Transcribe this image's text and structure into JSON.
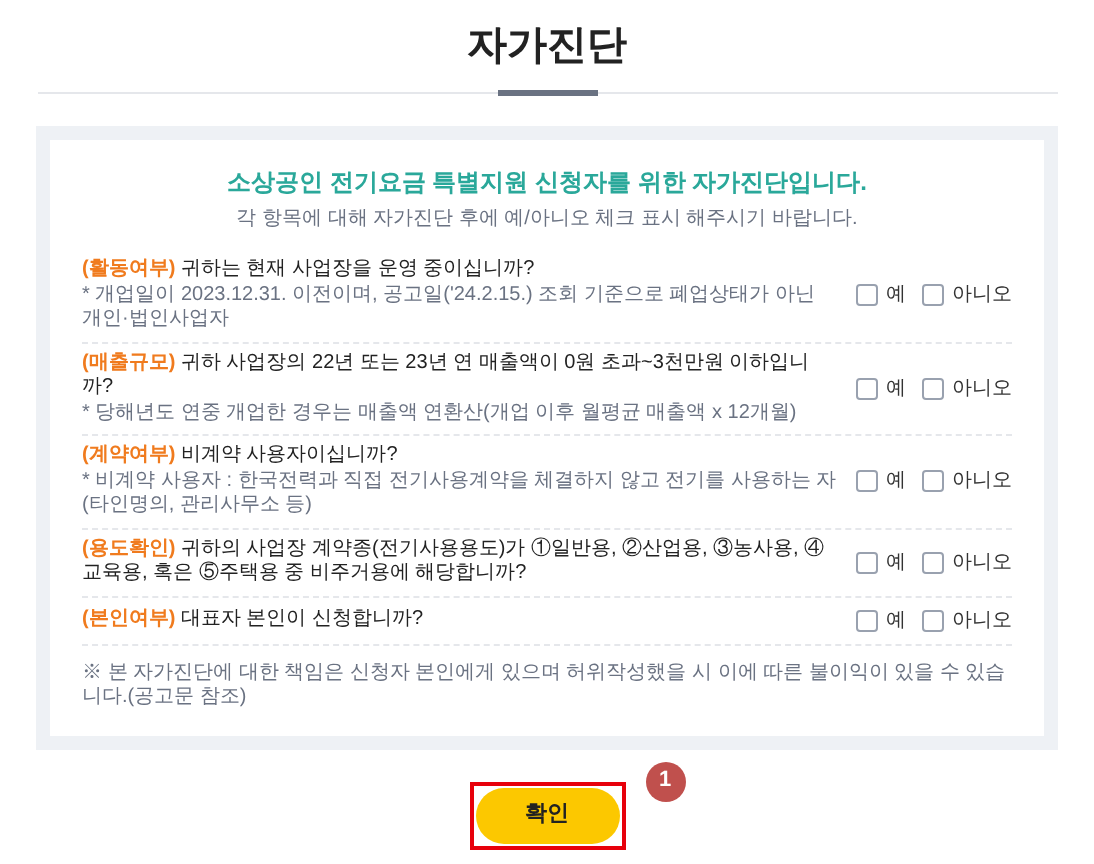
{
  "page_title": "자가진단",
  "heading": "소상공인 전기요금 특별지원 신청자를 위한 자가진단입니다.",
  "subheading": "각 항목에 대해 자가진단 후에 예/아니오 체크 표시 해주시기 바랍니다.",
  "questions": [
    {
      "tag": "(활동여부)",
      "text": "귀하는 현재 사업장을 운영 중이십니까?",
      "note": "* 개업일이 2023.12.31. 이전이며, 공고일('24.2.15.) 조회 기준으로 폐업상태가 아닌 개인·법인사업자",
      "options": [
        {
          "label": "예",
          "checked": false
        },
        {
          "label": "아니오",
          "checked": false
        }
      ]
    },
    {
      "tag": "(매출규모)",
      "text": "귀하 사업장의 22년 또는 23년 연 매출액이 0원 초과~3천만원 이하입니까?",
      "note": "* 당해년도 연중 개업한 경우는 매출액 연환산(개업 이후 월평균 매출액 x 12개월)",
      "options": [
        {
          "label": "예",
          "checked": false
        },
        {
          "label": "아니오",
          "checked": false
        }
      ]
    },
    {
      "tag": "(계약여부)",
      "text": "비계약 사용자이십니까?",
      "note": "* 비계약 사용자 : 한국전력과 직접 전기사용계약을 체결하지 않고 전기를 사용하는 자(타인명의, 관리사무소 등)",
      "options": [
        {
          "label": "예",
          "checked": false
        },
        {
          "label": "아니오",
          "checked": false
        }
      ]
    },
    {
      "tag": "(용도확인)",
      "text": "귀하의 사업장 계약종(전기사용용도)가 ①일반용, ②산업용, ③농사용, ④교육용, 혹은 ⑤주택용 중 비주거용에 해당합니까?",
      "options": [
        {
          "label": "예",
          "checked": false
        },
        {
          "label": "아니오",
          "checked": false
        }
      ]
    },
    {
      "tag": "(본인여부)",
      "text": "대표자 본인이 신청합니까?",
      "options": [
        {
          "label": "예",
          "checked": false
        },
        {
          "label": "아니오",
          "checked": false
        }
      ]
    }
  ],
  "disclaimer": "※ 본 자가진단에 대한 책임은 신청자 본인에게 있으며 허위작성했을 시 이에 따른 불이익이 있을 수 있습니다.(공고문 참조)",
  "confirm_button": "확인",
  "annotation_badge": "1"
}
